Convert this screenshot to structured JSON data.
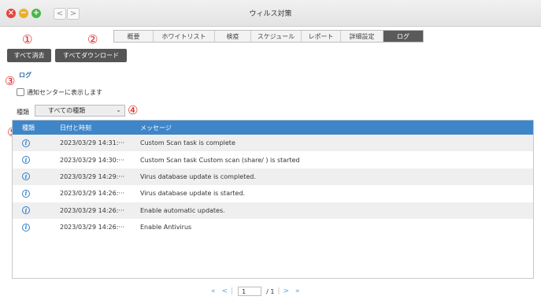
{
  "window": {
    "title": "ウィルス対策",
    "close_glyph": "×",
    "min_glyph": "−",
    "max_glyph": "+",
    "back_glyph": "<",
    "forward_glyph": ">"
  },
  "tabs": [
    {
      "label": "概要",
      "active": false
    },
    {
      "label": "ホワイトリスト",
      "active": false
    },
    {
      "label": "検疫",
      "active": false
    },
    {
      "label": "スケジュール",
      "active": false
    },
    {
      "label": "レポート",
      "active": false
    },
    {
      "label": "詳細設定",
      "active": false
    },
    {
      "label": "ログ",
      "active": true
    }
  ],
  "toolbar": {
    "clear_label": "すべて消去",
    "download_label": "すべてダウンロード"
  },
  "markers": [
    "①",
    "②",
    "③",
    "④",
    "⑤"
  ],
  "log": {
    "section_title": "ログ",
    "notify_label": "通知センターに表示します",
    "notify_checked": false,
    "filter_label": "種類",
    "filter_value": "すべての種類",
    "filter_chevron": "⌄"
  },
  "table": {
    "headers": [
      "種類",
      "日付と時刻",
      "メッセージ"
    ],
    "rows": [
      {
        "type_icon": "i",
        "date": "2023/03/29 14:31:···",
        "message": "Custom Scan task is complete"
      },
      {
        "type_icon": "i",
        "date": "2023/03/29 14:30:···",
        "message": "Custom Scan task Custom scan (share/ ) is started"
      },
      {
        "type_icon": "i",
        "date": "2023/03/29 14:29:···",
        "message": "Virus database update is completed."
      },
      {
        "type_icon": "i",
        "date": "2023/03/29 14:26:···",
        "message": "Virus database update is started."
      },
      {
        "type_icon": "i",
        "date": "2023/03/29 14:26:···",
        "message": "Enable automatic updates."
      },
      {
        "type_icon": "i",
        "date": "2023/03/29 14:26:···",
        "message": "Enable Antivirus"
      }
    ]
  },
  "pagination": {
    "first": "«",
    "prev": "<",
    "sep": "|",
    "page": "1",
    "total": "/ 1",
    "next": ">",
    "last": "»"
  },
  "colors": {
    "accent": "#3f86c8",
    "marker": "#dd2222",
    "button": "#555555"
  }
}
